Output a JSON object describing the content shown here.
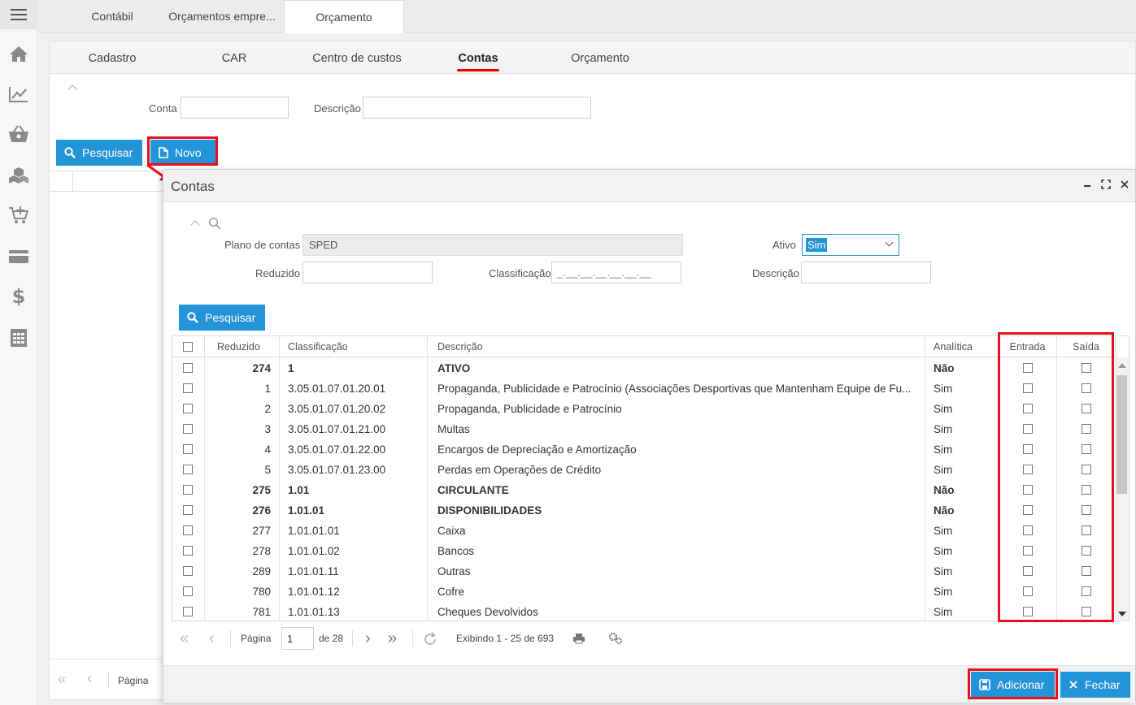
{
  "top_tabs": [
    "Contábil",
    "Orçamentos empre...",
    "Orçamento"
  ],
  "sub_tabs": [
    "Cadastro",
    "CAR",
    "Centro de custos",
    "Contas",
    "Orçamento"
  ],
  "filter": {
    "conta_label": "Conta",
    "descricao_label": "Descrição",
    "search_button": "Pesquisar",
    "new_button": "Novo"
  },
  "modal": {
    "title": "Contas",
    "plano_label": "Plano de contas",
    "plano_value": "SPED",
    "ativo_label": "Ativo",
    "ativo_value": "Sim",
    "reduzido_label": "Reduzido",
    "classificacao_label": "Classificação",
    "classificacao_placeholder": "_.__.__.__.__.__.__",
    "descricao_label": "Descrição",
    "search_button": "Pesquisar",
    "columns": [
      "Reduzido",
      "Classificação",
      "Descrição",
      "Analítica",
      "Entrada",
      "Saída"
    ],
    "rows": [
      {
        "reduzido": "274",
        "classificacao": "1",
        "descricao": "ATIVO",
        "analitica": "Não",
        "bold": true
      },
      {
        "reduzido": "1",
        "classificacao": "3.05.01.07.01.20.01",
        "descricao": "Propaganda, Publicidade e Patrocínio (Associações Desportivas que Mantenham Equipe de Fu...",
        "analitica": "Sim",
        "bold": false
      },
      {
        "reduzido": "2",
        "classificacao": "3.05.01.07.01.20.02",
        "descricao": "Propaganda, Publicidade e Patrocínio",
        "analitica": "Sim",
        "bold": false
      },
      {
        "reduzido": "3",
        "classificacao": "3.05.01.07.01.21.00",
        "descricao": "Multas",
        "analitica": "Sim",
        "bold": false
      },
      {
        "reduzido": "4",
        "classificacao": "3.05.01.07.01.22.00",
        "descricao": "Encargos de Depreciação e Amortização",
        "analitica": "Sim",
        "bold": false
      },
      {
        "reduzido": "5",
        "classificacao": "3.05.01.07.01.23.00",
        "descricao": "Perdas em Operações de Crédito",
        "analitica": "Sim",
        "bold": false
      },
      {
        "reduzido": "275",
        "classificacao": "1.01",
        "descricao": "CIRCULANTE",
        "analitica": "Não",
        "bold": true
      },
      {
        "reduzido": "276",
        "classificacao": "1.01.01",
        "descricao": "DISPONIBILIDADES",
        "analitica": "Não",
        "bold": true
      },
      {
        "reduzido": "277",
        "classificacao": "1.01.01.01",
        "descricao": "Caixa",
        "analitica": "Sim",
        "bold": false
      },
      {
        "reduzido": "278",
        "classificacao": "1.01.01.02",
        "descricao": "Bancos",
        "analitica": "Sim",
        "bold": false
      },
      {
        "reduzido": "289",
        "classificacao": "1.01.01.11",
        "descricao": "Outras",
        "analitica": "Sim",
        "bold": false
      },
      {
        "reduzido": "780",
        "classificacao": "1.01.01.12",
        "descricao": "Cofre",
        "analitica": "Sim",
        "bold": false
      },
      {
        "reduzido": "781",
        "classificacao": "1.01.01.13",
        "descricao": "Cheques Devolvidos",
        "analitica": "Sim",
        "bold": false
      }
    ],
    "pager": {
      "page_label": "Página",
      "page_value": "1",
      "of_label": "de 28",
      "display_text": "Exibindo 1 - 25 de 693"
    },
    "add_button": "Adicionar",
    "close_button": "Fechar"
  },
  "main_pager_label": "Página",
  "colors": {
    "primary": "#2494d8",
    "highlight": "#e8101a"
  },
  "icons": [
    "menu-icon",
    "home-icon",
    "chart-icon",
    "basket-icon",
    "boxes-icon",
    "cart-add-icon",
    "card-icon",
    "dollar-icon",
    "calculator-icon"
  ]
}
